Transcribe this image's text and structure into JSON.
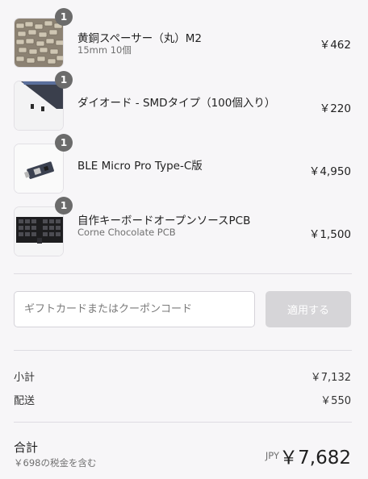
{
  "items": [
    {
      "quantity": "1",
      "name": "黄銅スペーサー（丸）M2",
      "variant": "15mm 10個",
      "price": "￥462",
      "image": "brass-spacers"
    },
    {
      "quantity": "1",
      "name": "ダイオード - SMDタイプ（100個入り）",
      "variant": "",
      "price": "￥220",
      "image": "smd-diode-tape"
    },
    {
      "quantity": "1",
      "name": "BLE Micro Pro Type-C版",
      "variant": "",
      "price": "￥4,950",
      "image": "micro-controller-board"
    },
    {
      "quantity": "1",
      "name": "自作キーボードオープンソースPCB",
      "variant": "Corne Chocolate PCB",
      "price": "￥1,500",
      "image": "keyboard-pcb"
    }
  ],
  "coupon": {
    "placeholder": "ギフトカードまたはクーポンコード",
    "apply_label": "適用する"
  },
  "summary": {
    "subtotal_label": "小計",
    "subtotal_value": "￥7,132",
    "shipping_label": "配送",
    "shipping_value": "￥550",
    "total_label": "合計",
    "tax_note": "￥698の税金を含む",
    "currency": "JPY",
    "total_value": "￥7,682"
  },
  "colors": {
    "badge": "#6b6b6b",
    "apply_button_disabled": "#d6d5d8",
    "background": "#f7f6f8"
  }
}
